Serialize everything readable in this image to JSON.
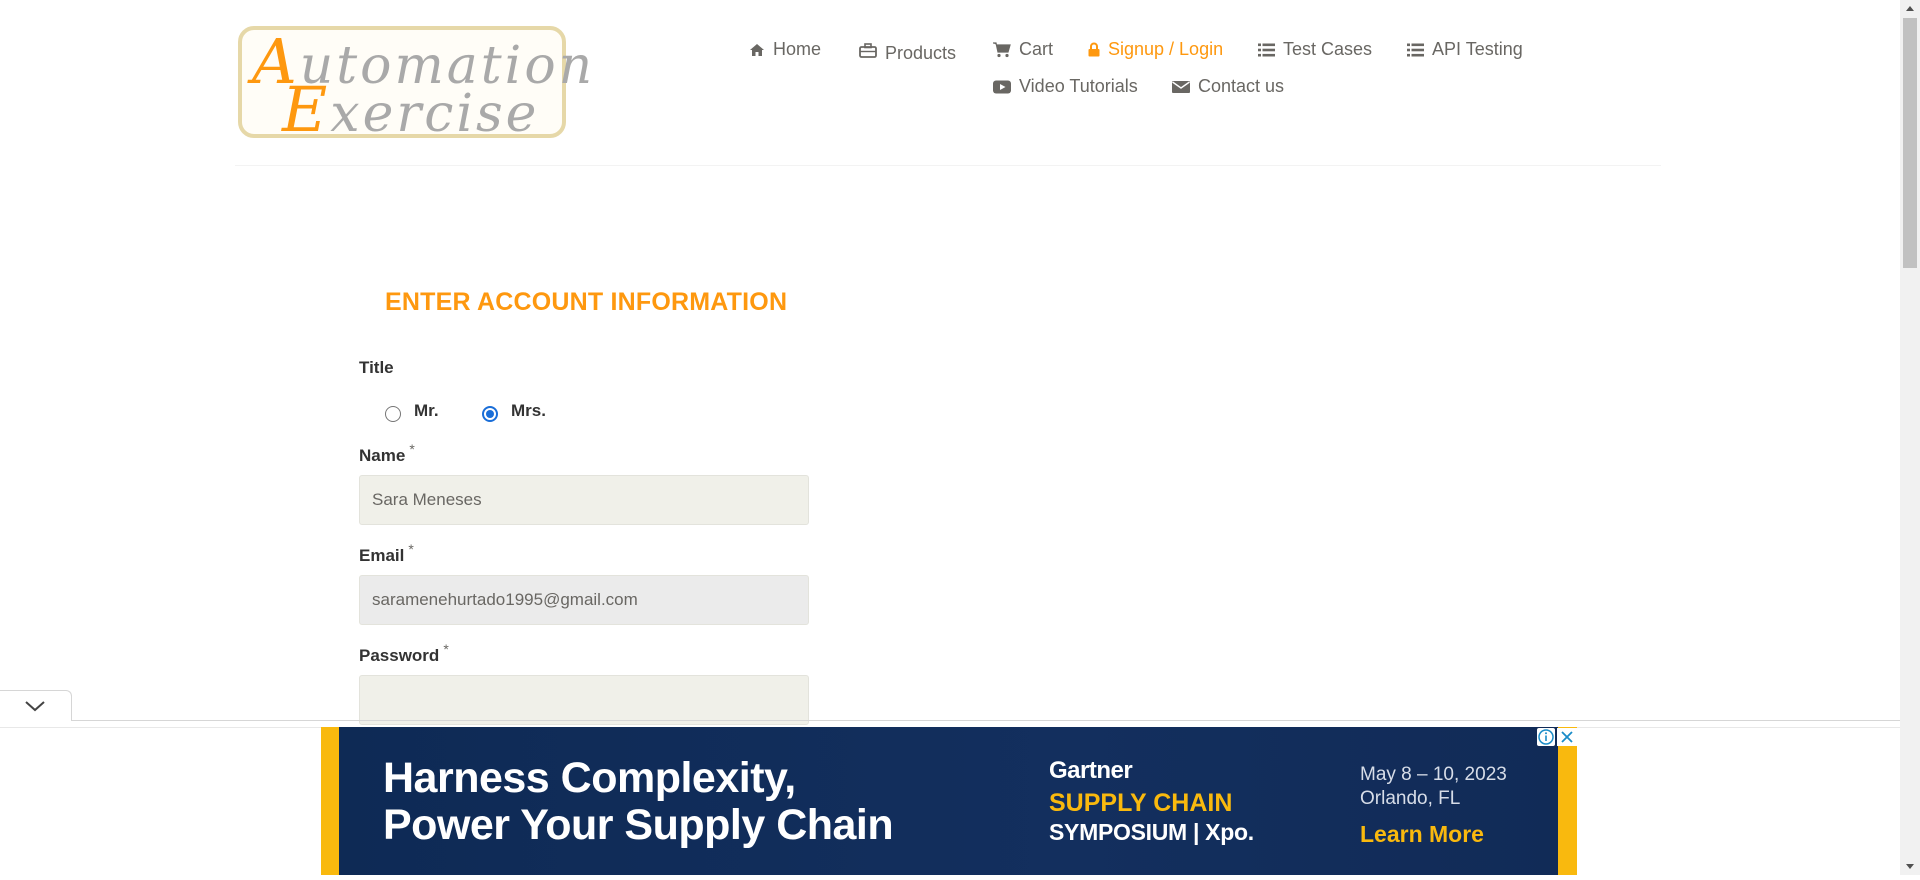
{
  "logo": {
    "line1_cap": "A",
    "line1_rest": "utomation",
    "line2_cap": "E",
    "line2_rest": "xercise"
  },
  "nav": [
    {
      "label": "Home",
      "icon": "home-icon"
    },
    {
      "label": "Products",
      "icon": "briefcase-icon"
    },
    {
      "label": "Cart",
      "icon": "cart-icon"
    },
    {
      "label": "Signup / Login",
      "icon": "lock-icon",
      "active": true
    },
    {
      "label": "Test Cases",
      "icon": "list-icon"
    },
    {
      "label": "API Testing",
      "icon": "list-icon"
    },
    {
      "label": "Video Tutorials",
      "icon": "youtube-play-icon"
    },
    {
      "label": "Contact us",
      "icon": "envelope-icon"
    }
  ],
  "form": {
    "heading": "ENTER ACCOUNT INFORMATION",
    "title_label": "Title",
    "title_options": [
      {
        "label": "Mr.",
        "checked": false
      },
      {
        "label": "Mrs.",
        "checked": true
      }
    ],
    "name_label": "Name",
    "name_value": "Sara Meneses",
    "email_label": "Email",
    "email_value": "saramenehurtado1995@gmail.com",
    "password_label": "Password",
    "password_value": "",
    "required_mark": "*"
  },
  "ad": {
    "headline_line1": "Harness Complexity,",
    "headline_line2": "Power Your Supply Chain",
    "brand": "Gartner",
    "event_line1": "SUPPLY CHAIN",
    "event_line2": "SYMPOSIUM | Xpo.",
    "date_line1": "May 8 – 10, 2023",
    "date_line2": "Orlando, FL",
    "cta": "Learn More"
  },
  "colors": {
    "accent": "#fe980f",
    "text": "#696763",
    "ad_bg": "#0e2a55",
    "ad_accent": "#f9b90e",
    "radio_checked": "#1a6ed8"
  }
}
